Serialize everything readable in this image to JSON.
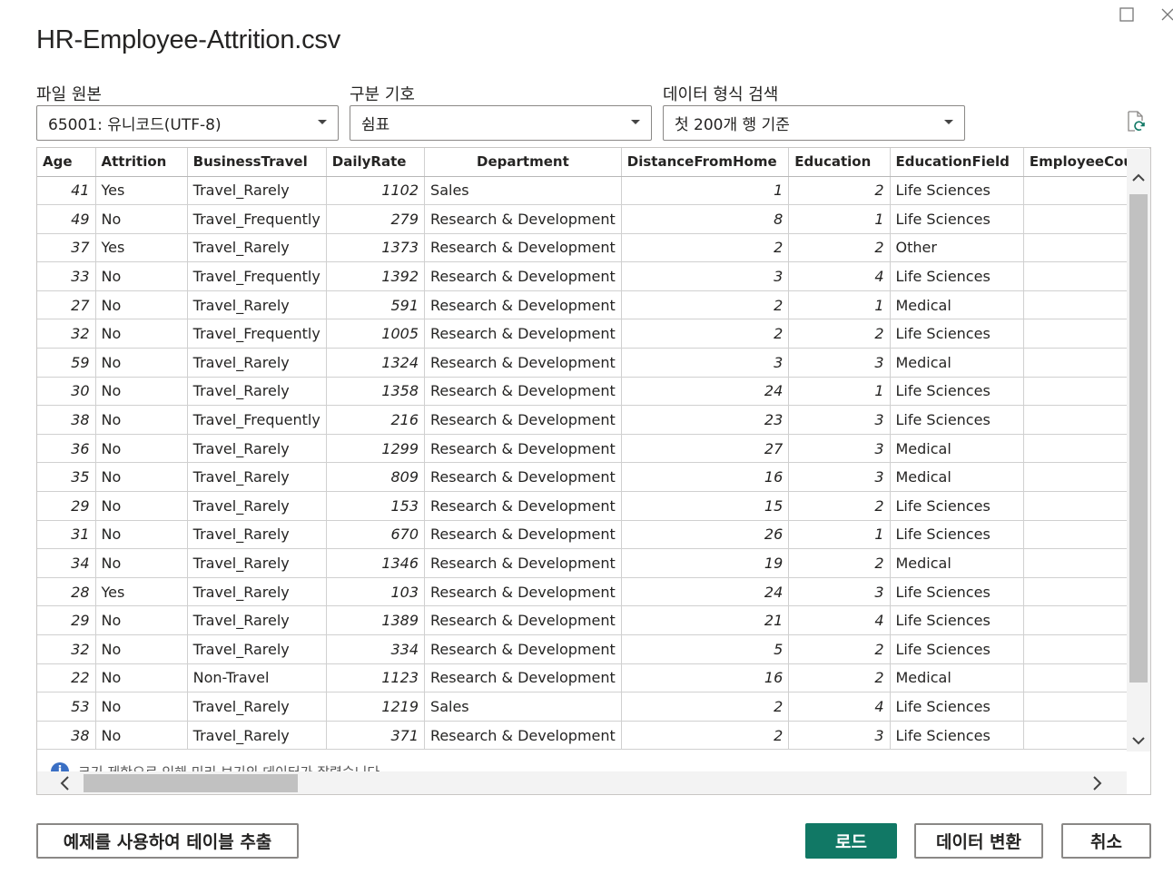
{
  "window": {
    "title": "HR-Employee-Attrition.csv"
  },
  "options": {
    "file_origin": {
      "label": "파일 원본",
      "value": "65001: 유니코드(UTF-8)"
    },
    "delimiter": {
      "label": "구분 기호",
      "value": "쉼표"
    },
    "type_detection": {
      "label": "데이터 형식 검색",
      "value": "첫 200개 행 기준"
    }
  },
  "table": {
    "columns": [
      "Age",
      "Attrition",
      "BusinessTravel",
      "DailyRate",
      "Department",
      "DistanceFromHome",
      "Education",
      "EducationField",
      "EmployeeCount"
    ],
    "rows": [
      [
        "41",
        "Yes",
        "Travel_Rarely",
        "1102",
        "Sales",
        "1",
        "2",
        "Life Sciences",
        ""
      ],
      [
        "49",
        "No",
        "Travel_Frequently",
        "279",
        "Research & Development",
        "8",
        "1",
        "Life Sciences",
        ""
      ],
      [
        "37",
        "Yes",
        "Travel_Rarely",
        "1373",
        "Research & Development",
        "2",
        "2",
        "Other",
        ""
      ],
      [
        "33",
        "No",
        "Travel_Frequently",
        "1392",
        "Research & Development",
        "3",
        "4",
        "Life Sciences",
        ""
      ],
      [
        "27",
        "No",
        "Travel_Rarely",
        "591",
        "Research & Development",
        "2",
        "1",
        "Medical",
        ""
      ],
      [
        "32",
        "No",
        "Travel_Frequently",
        "1005",
        "Research & Development",
        "2",
        "2",
        "Life Sciences",
        ""
      ],
      [
        "59",
        "No",
        "Travel_Rarely",
        "1324",
        "Research & Development",
        "3",
        "3",
        "Medical",
        ""
      ],
      [
        "30",
        "No",
        "Travel_Rarely",
        "1358",
        "Research & Development",
        "24",
        "1",
        "Life Sciences",
        ""
      ],
      [
        "38",
        "No",
        "Travel_Frequently",
        "216",
        "Research & Development",
        "23",
        "3",
        "Life Sciences",
        ""
      ],
      [
        "36",
        "No",
        "Travel_Rarely",
        "1299",
        "Research & Development",
        "27",
        "3",
        "Medical",
        ""
      ],
      [
        "35",
        "No",
        "Travel_Rarely",
        "809",
        "Research & Development",
        "16",
        "3",
        "Medical",
        ""
      ],
      [
        "29",
        "No",
        "Travel_Rarely",
        "153",
        "Research & Development",
        "15",
        "2",
        "Life Sciences",
        ""
      ],
      [
        "31",
        "No",
        "Travel_Rarely",
        "670",
        "Research & Development",
        "26",
        "1",
        "Life Sciences",
        ""
      ],
      [
        "34",
        "No",
        "Travel_Rarely",
        "1346",
        "Research & Development",
        "19",
        "2",
        "Medical",
        ""
      ],
      [
        "28",
        "Yes",
        "Travel_Rarely",
        "103",
        "Research & Development",
        "24",
        "3",
        "Life Sciences",
        ""
      ],
      [
        "29",
        "No",
        "Travel_Rarely",
        "1389",
        "Research & Development",
        "21",
        "4",
        "Life Sciences",
        ""
      ],
      [
        "32",
        "No",
        "Travel_Rarely",
        "334",
        "Research & Development",
        "5",
        "2",
        "Life Sciences",
        ""
      ],
      [
        "22",
        "No",
        "Non-Travel",
        "1123",
        "Research & Development",
        "16",
        "2",
        "Medical",
        ""
      ],
      [
        "53",
        "No",
        "Travel_Rarely",
        "1219",
        "Sales",
        "2",
        "4",
        "Life Sciences",
        ""
      ],
      [
        "38",
        "No",
        "Travel_Rarely",
        "371",
        "Research & Development",
        "2",
        "3",
        "Life Sciences",
        ""
      ]
    ],
    "numeric_columns": [
      0,
      3,
      5,
      6
    ]
  },
  "notice": {
    "text": "크기 제한으로 인해 미리 보기의 데이터가 잘렸습니다."
  },
  "buttons": {
    "extract": "예제를 사용하여 테이블 추출",
    "load": "로드",
    "transform": "데이터 변환",
    "cancel": "취소"
  },
  "colors": {
    "primary": "#117865",
    "border": "#8a8886"
  }
}
